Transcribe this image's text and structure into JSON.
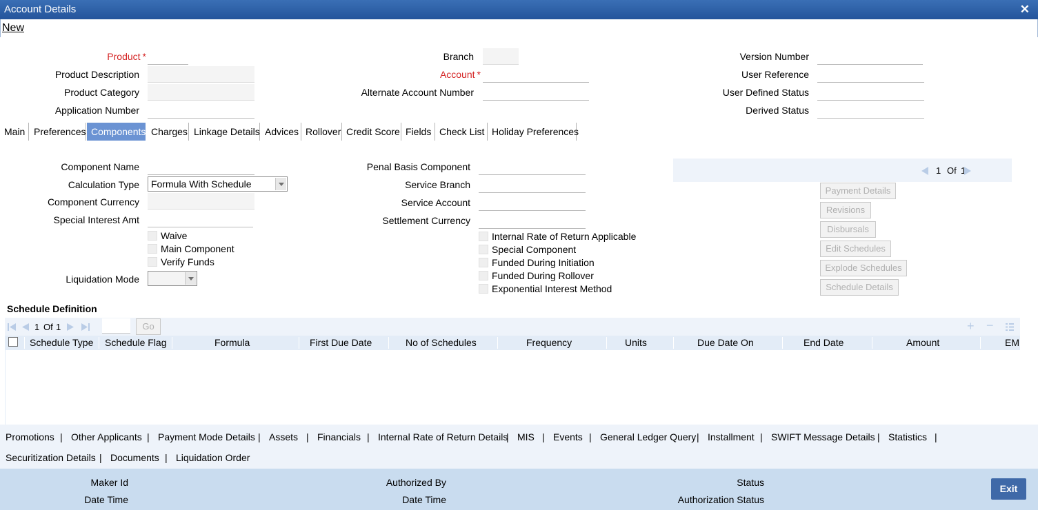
{
  "window": {
    "title": "Account Details",
    "close": "✕"
  },
  "menu": {
    "new_label": "New"
  },
  "header": {
    "product": "Product",
    "product_description": "Product Description",
    "product_category": "Product Category",
    "application_number": "Application Number",
    "branch": "Branch",
    "account": "Account",
    "alternate_account_number": "Alternate Account Number",
    "version_number": "Version Number",
    "user_reference": "User Reference",
    "user_defined_status": "User Defined Status",
    "derived_status": "Derived Status",
    "required_mark": "*"
  },
  "tabs": [
    "Main",
    "Preferences",
    "Components",
    "Charges",
    "Linkage Details",
    "Advices",
    "Rollover",
    "Credit Score",
    "Fields",
    "Check List",
    "Holiday Preferences"
  ],
  "active_tab": "Components",
  "components": {
    "component_name": "Component Name",
    "calculation_type": "Calculation Type",
    "calculation_type_value": "Formula With Schedule",
    "component_currency": "Component Currency",
    "special_interest_amt": "Special Interest Amt",
    "waive": "Waive",
    "main_component": "Main Component",
    "verify_funds": "Verify Funds",
    "liquidation_mode": "Liquidation Mode",
    "penal_basis_component": "Penal Basis Component",
    "service_branch": "Service Branch",
    "service_account": "Service Account",
    "settlement_currency": "Settlement Currency",
    "irr_applicable": "Internal Rate of Return Applicable",
    "special_component": "Special Component",
    "funded_during_initiation": "Funded During Initiation",
    "funded_during_rollover": "Funded During Rollover",
    "exponential_interest_method": "Exponential Interest Method"
  },
  "pager": {
    "current": "1",
    "of_label": "Of",
    "total": "1"
  },
  "side_buttons": [
    "Payment Details",
    "Revisions",
    "Disbursals",
    "Edit Schedules",
    "Explode Schedules",
    "Schedule Details"
  ],
  "schedule": {
    "title": "Schedule Definition",
    "page_current": "1",
    "page_of": "Of",
    "page_total": "1",
    "go": "Go",
    "columns": [
      "Schedule Type",
      "Schedule Flag",
      "Formula",
      "First Due Date",
      "No of Schedules",
      "Frequency",
      "Units",
      "Due Date On",
      "End Date",
      "Amount",
      "EM"
    ]
  },
  "links_row1": [
    "Promotions",
    "Other Applicants",
    "Payment Mode Details",
    "Assets",
    "Financials",
    "Internal Rate of Return Details",
    "MIS",
    "Events",
    "General Ledger Query",
    "Installment",
    "SWIFT Message Details",
    "Statistics"
  ],
  "links_row2": [
    "Securitization Details",
    "Documents",
    "Liquidation Order"
  ],
  "footer": {
    "maker_id": "Maker Id",
    "date_time": "Date Time",
    "authorized_by": "Authorized By",
    "date_time_2": "Date Time",
    "status": "Status",
    "authorization_status": "Authorization Status",
    "exit": "Exit"
  }
}
